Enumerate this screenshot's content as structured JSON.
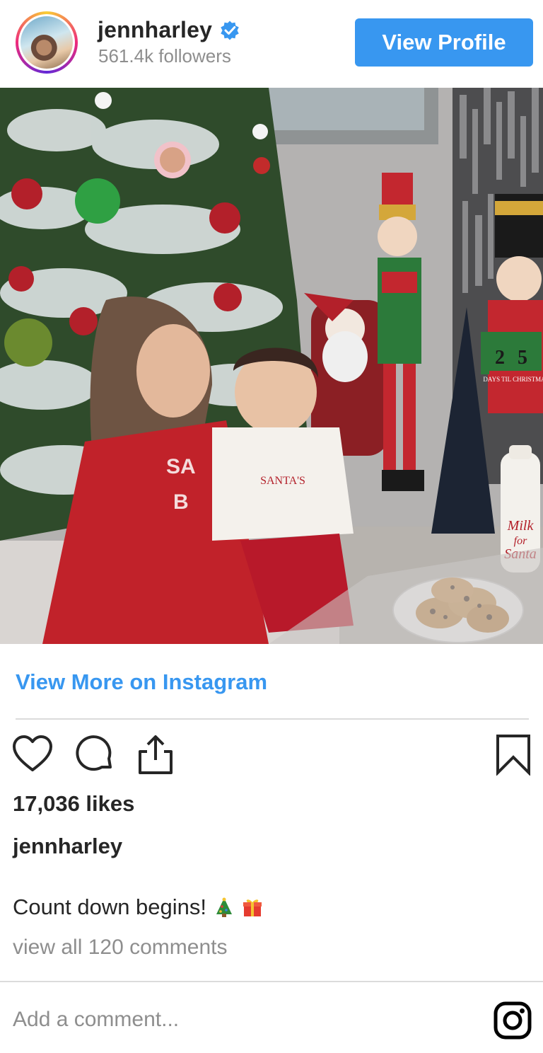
{
  "header": {
    "username": "jennharley",
    "followers": "561.4k followers",
    "view_profile_label": "View Profile",
    "verified_color": "#3897f0"
  },
  "photo": {
    "milk_label_1": "Milk",
    "milk_label_2": "for",
    "milk_label_3": "Santa",
    "calendar_digit_1": "2",
    "calendar_digit_2": "5",
    "calendar_label": "DAYS TIL CHRISTMAS",
    "shirt_text": "SANTA'S"
  },
  "actions": {
    "icons": [
      "heart-icon",
      "comment-icon",
      "share-icon",
      "bookmark-icon"
    ]
  },
  "post": {
    "view_more": "View More on Instagram",
    "likes": "17,036 likes",
    "caption_user": "jennharley",
    "caption_text": "Count down begins!",
    "caption_emojis": [
      "christmas-tree-emoji",
      "gift-emoji"
    ],
    "view_comments": "view all 120 comments"
  },
  "comment": {
    "placeholder": "Add a comment..."
  },
  "colors": {
    "accent": "#3897f0",
    "muted": "#8e8e8e",
    "text": "#262626"
  }
}
